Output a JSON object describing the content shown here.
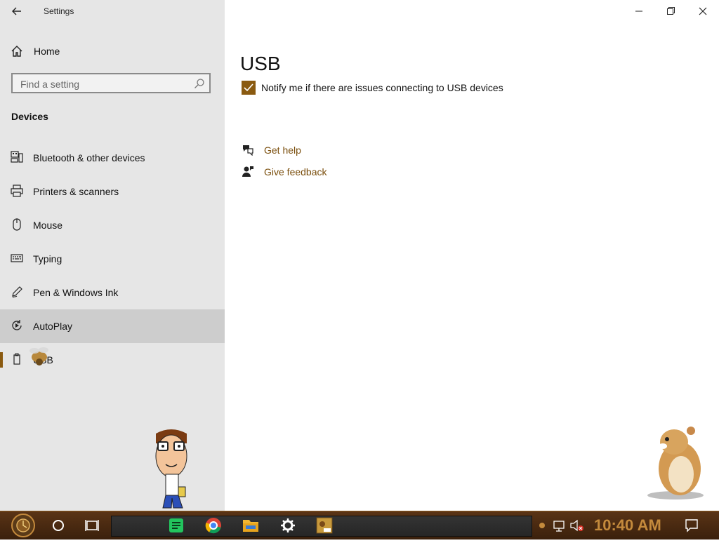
{
  "window": {
    "title": "Settings"
  },
  "sidebar": {
    "home_label": "Home",
    "search_placeholder": "Find a setting",
    "section_label": "Devices",
    "items": [
      {
        "label": "Bluetooth & other devices",
        "icon": "bluetooth-devices-icon"
      },
      {
        "label": "Printers & scanners",
        "icon": "printer-icon"
      },
      {
        "label": "Mouse",
        "icon": "mouse-icon"
      },
      {
        "label": "Typing",
        "icon": "keyboard-icon"
      },
      {
        "label": "Pen & Windows Ink",
        "icon": "pen-icon"
      },
      {
        "label": "AutoPlay",
        "icon": "autoplay-icon"
      },
      {
        "label": "USB",
        "icon": "usb-icon"
      }
    ]
  },
  "main": {
    "title": "USB",
    "notify_checkbox": {
      "label": "Notify me if there are issues connecting to USB devices",
      "checked": true
    },
    "links": [
      {
        "label": "Get help",
        "icon": "help-chat-icon"
      },
      {
        "label": "Give feedback",
        "icon": "feedback-person-icon"
      }
    ]
  },
  "taskbar": {
    "clock": "10:40 AM"
  },
  "colors": {
    "accent": "#8a5a10",
    "link": "#7a4e0c",
    "sidebar_bg": "#e6e6e6",
    "hover_bg": "#cdcdcd",
    "taskbar_bg": "#4a2a12",
    "clock": "#c48a3c"
  }
}
